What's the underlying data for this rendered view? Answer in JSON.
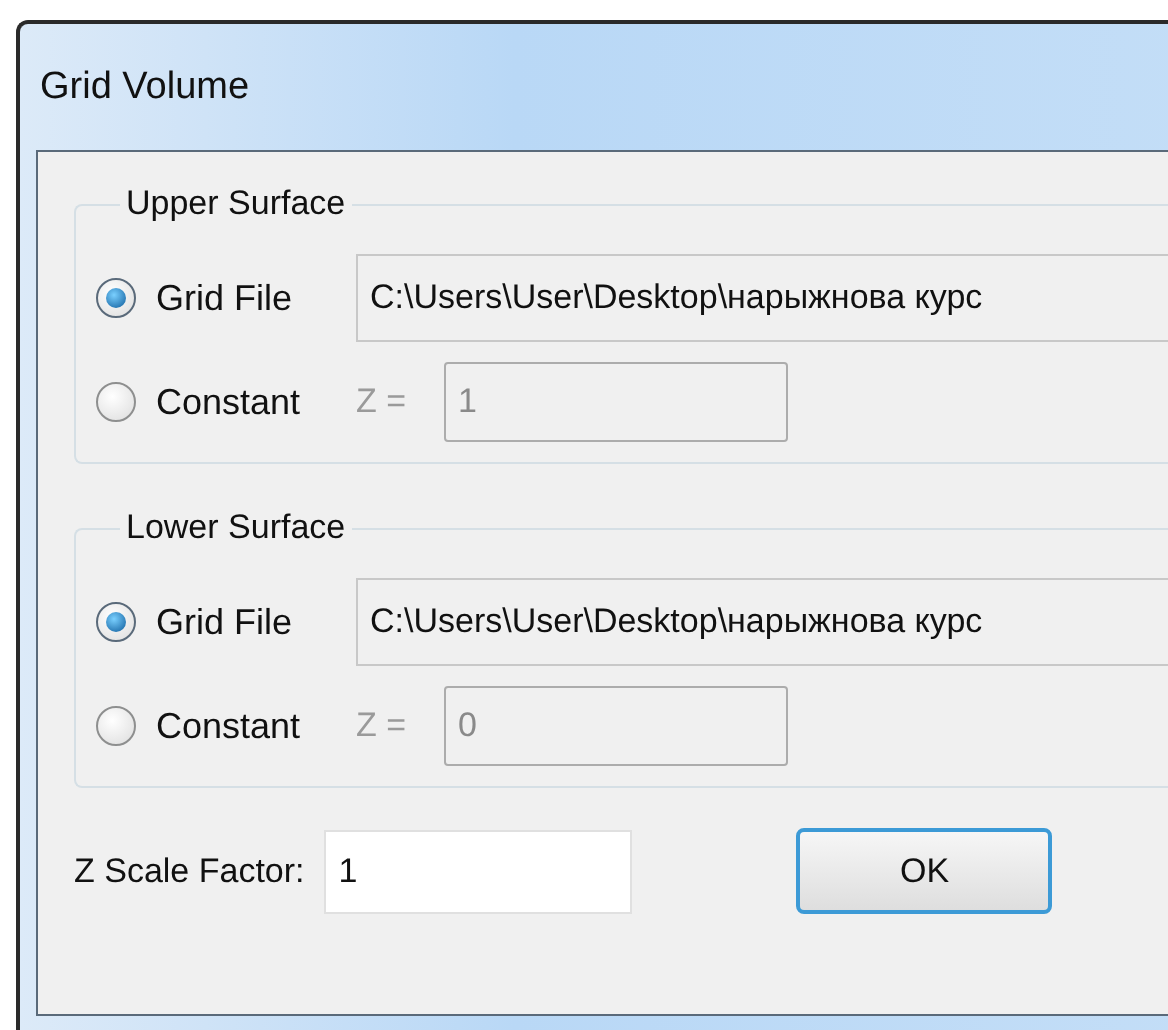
{
  "window": {
    "title": "Grid Volume"
  },
  "groups": [
    {
      "title": "Upper Surface",
      "options": [
        {
          "kind": "file",
          "label": "Grid File",
          "selected": true,
          "value": "C:\\Users\\User\\Desktop\\нарыжнова курс"
        },
        {
          "kind": "constant",
          "label": "Constant",
          "selected": false,
          "prefix": "Z =",
          "value": "1"
        }
      ]
    },
    {
      "title": "Lower Surface",
      "options": [
        {
          "kind": "file",
          "label": "Grid File",
          "selected": true,
          "value": "C:\\Users\\User\\Desktop\\нарыжнова курс"
        },
        {
          "kind": "constant",
          "label": "Constant",
          "selected": false,
          "prefix": "Z =",
          "value": "0"
        }
      ]
    }
  ],
  "scale": {
    "label": "Z Scale Factor:",
    "value": "1"
  },
  "buttons": [
    {
      "label": "OK",
      "focused": true
    }
  ]
}
